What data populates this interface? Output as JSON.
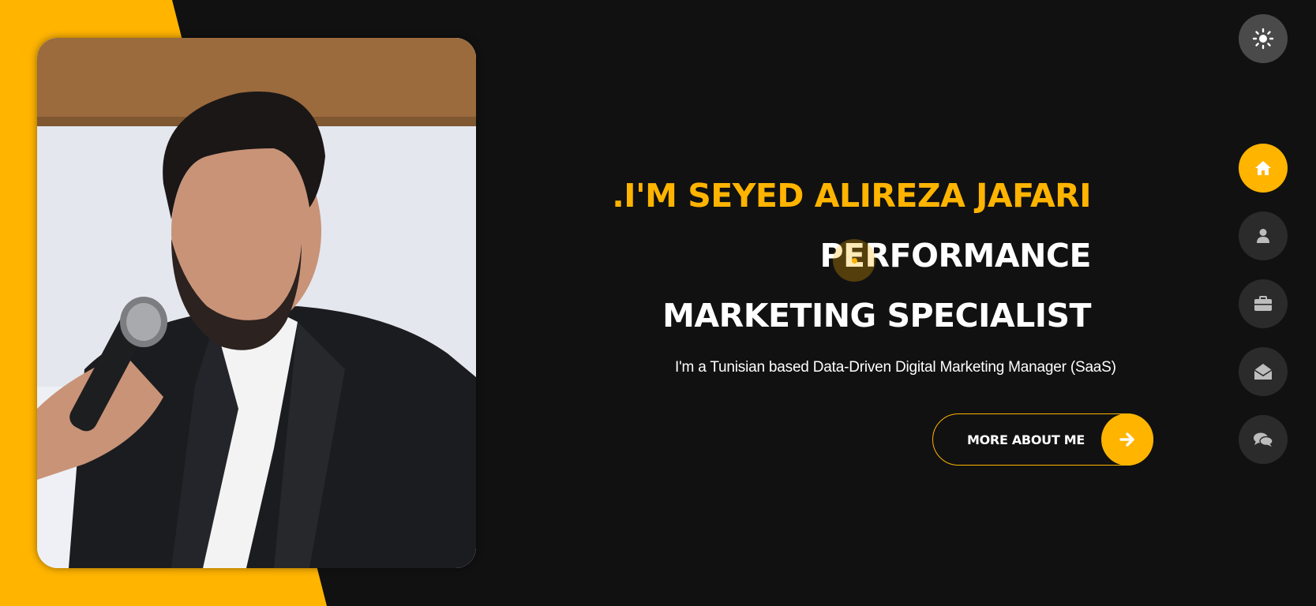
{
  "hero": {
    "name_line": ".I'M SEYED ALIREZA JAFARI",
    "role_line_1": "PERFORMANCE",
    "role_line_2": "MARKETING SPECIALIST",
    "tagline": "I'm a Tunisian based Data-Driven Digital Marketing Manager (SaaS)",
    "cta_label": "MORE ABOUT ME"
  },
  "colors": {
    "accent": "#ffb400",
    "background": "#111111",
    "nav_button": "#2b2b2b"
  },
  "side_nav": [
    {
      "icon": "home-icon",
      "active": true
    },
    {
      "icon": "user-icon",
      "active": false
    },
    {
      "icon": "briefcase-icon",
      "active": false
    },
    {
      "icon": "envelope-open-icon",
      "active": false
    },
    {
      "icon": "comments-icon",
      "active": false
    }
  ],
  "theme_toggle": {
    "icon": "sun-icon"
  }
}
